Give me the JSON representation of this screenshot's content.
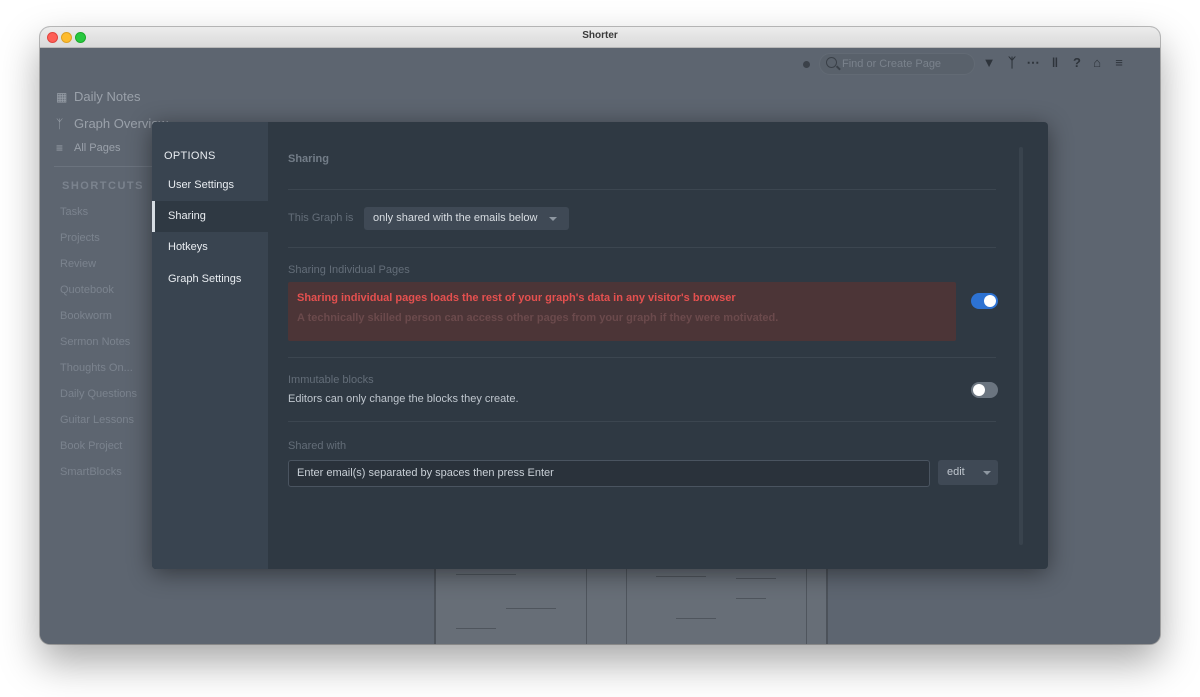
{
  "window": {
    "title": "Shorter"
  },
  "background": {
    "graph_name": "",
    "nav": [
      {
        "label": "Daily Notes",
        "icon": "calendar-icon"
      },
      {
        "label": "Graph Overview",
        "icon": "graph-icon"
      },
      {
        "label": "All Pages",
        "icon": "list-icon"
      }
    ],
    "shortcuts_title": "SHORTCUTS",
    "shortcuts": [
      "Tasks",
      "Projects",
      "Review",
      "Quotebook",
      "Bookworm",
      "Sermon Notes",
      "Thoughts On...",
      "Daily Questions",
      "Guitar Lessons",
      "Book Project",
      "SmartBlocks"
    ],
    "search_placeholder": "Find or Create Page"
  },
  "modal": {
    "sidebar": {
      "header": "OPTIONS",
      "items": [
        {
          "label": "User Settings",
          "active": false
        },
        {
          "label": "Sharing",
          "active": true
        },
        {
          "label": "Hotkeys",
          "active": false
        },
        {
          "label": "Graph Settings",
          "active": false
        }
      ]
    },
    "section_title": "Sharing",
    "graph_is_label": "This Graph is",
    "graph_is_value": "only shared with the emails below",
    "sharing_pages": {
      "label": "Sharing Individual Pages",
      "warning_title": "Sharing individual pages loads the rest of your graph's data in any visitor's browser",
      "warning_sub": "A technically skilled person can access other pages from your graph if they were motivated.",
      "enabled": true
    },
    "immutable": {
      "label": "Immutable blocks",
      "description": "Editors can only change the blocks they create.",
      "enabled": false
    },
    "shared_with": {
      "label": "Shared with",
      "placeholder": "Enter email(s) separated by spaces then press Enter",
      "permission": "edit"
    }
  },
  "colors": {
    "toggle_on": "#2d72d2",
    "warning_text": "#e5504f",
    "warning_bg": "#4c3537"
  }
}
